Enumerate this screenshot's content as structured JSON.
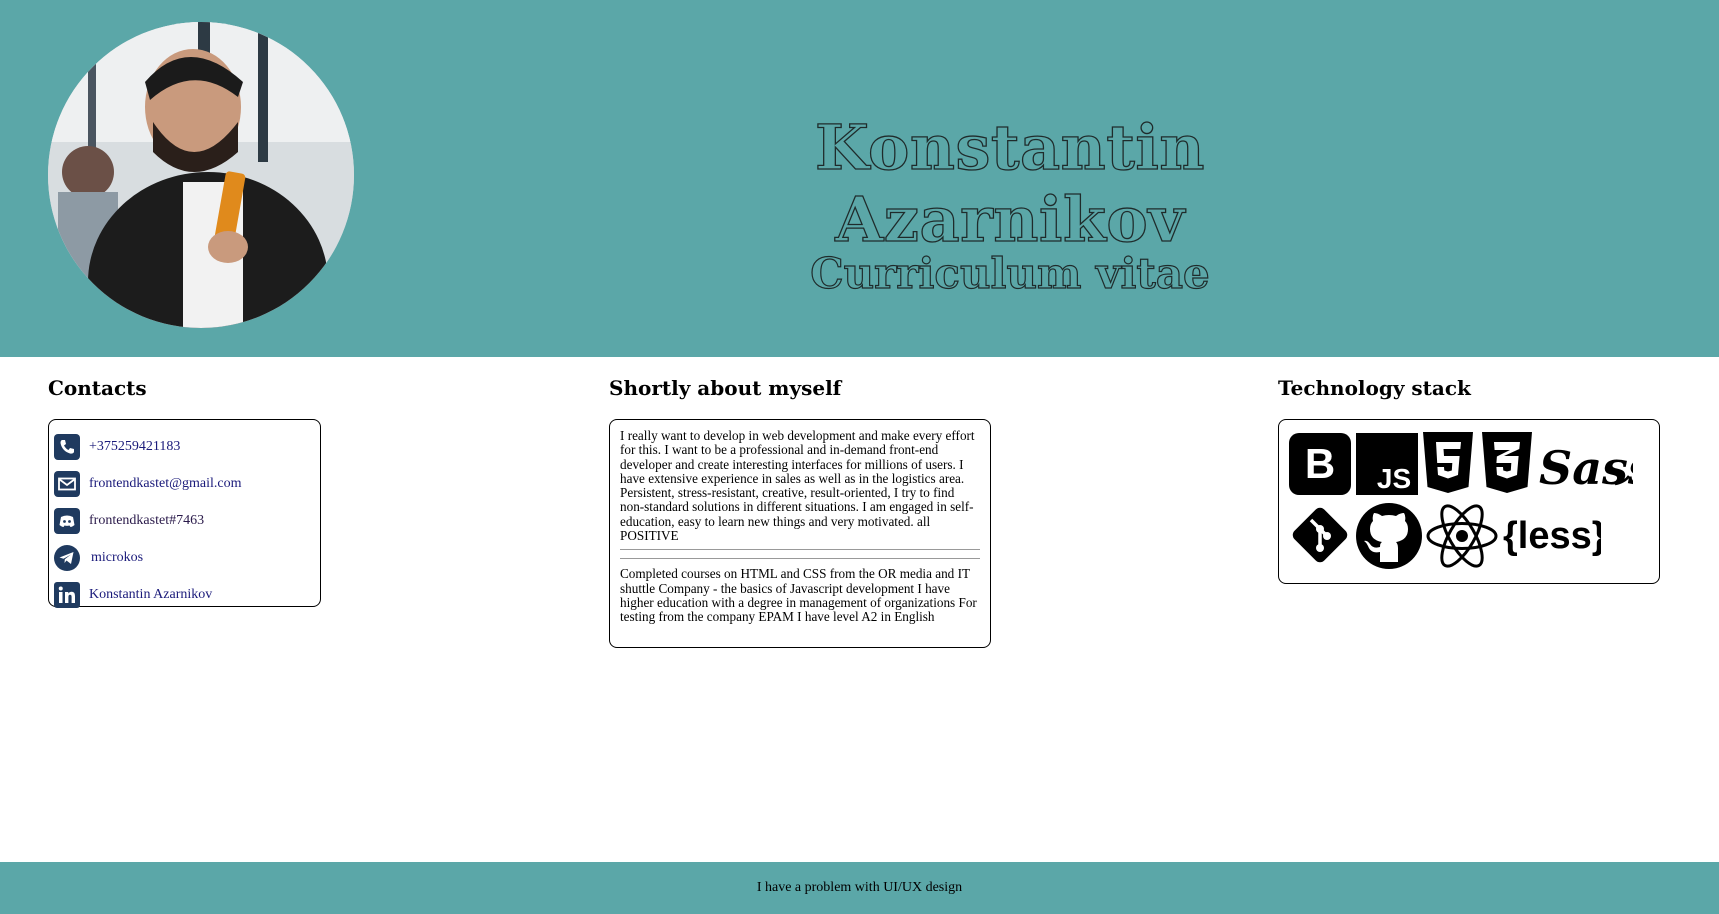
{
  "header": {
    "name": "Konstantin Azarnikov",
    "subtitle": "Curriculum vitae"
  },
  "contacts": {
    "title": "Contacts",
    "items": [
      {
        "icon": "phone-icon",
        "label": "+375259421183"
      },
      {
        "icon": "envelope-icon",
        "label": "frontendkastet@gmail.com"
      },
      {
        "icon": "discord-icon",
        "label": "frontendkastet#7463"
      },
      {
        "icon": "telegram-icon",
        "label": "microkos"
      },
      {
        "icon": "linkedin-icon",
        "label": "Konstantin Azarnikov"
      }
    ]
  },
  "about": {
    "title": "Shortly about myself",
    "paragraph1": "I really want to develop in web development and make every effort for this. I want to be a professional and in-demand front-end developer and create interesting interfaces for millions of users. I have extensive experience in sales as well as in the logistics area. Persistent, stress-resistant, creative, result-oriented, I try to find non-standard solutions in different situations. I am engaged in self-education, easy to learn new things and very motivated. all POSITIVE",
    "paragraph2": "Completed courses on HTML and CSS from the OR media and IT shuttle Company - the basics of Javascript development I have higher education with a degree in management of organizations For testing from the company EPAM I have level A2 in English"
  },
  "tech": {
    "title": "Technology stack",
    "icons": [
      "bootstrap-icon",
      "javascript-icon",
      "html5-icon",
      "css3-icon",
      "sass-icon",
      "git-icon",
      "github-icon",
      "react-icon",
      "less-icon"
    ],
    "js_label": "JS",
    "bootstrap_label": "B",
    "sass_label": "Sass",
    "less_label": "{less}"
  },
  "footer": {
    "text": "I have a problem with UI/UX design"
  },
  "colors": {
    "header_bg": "#5ba7a8",
    "icon_bg": "#1f3a5f"
  }
}
